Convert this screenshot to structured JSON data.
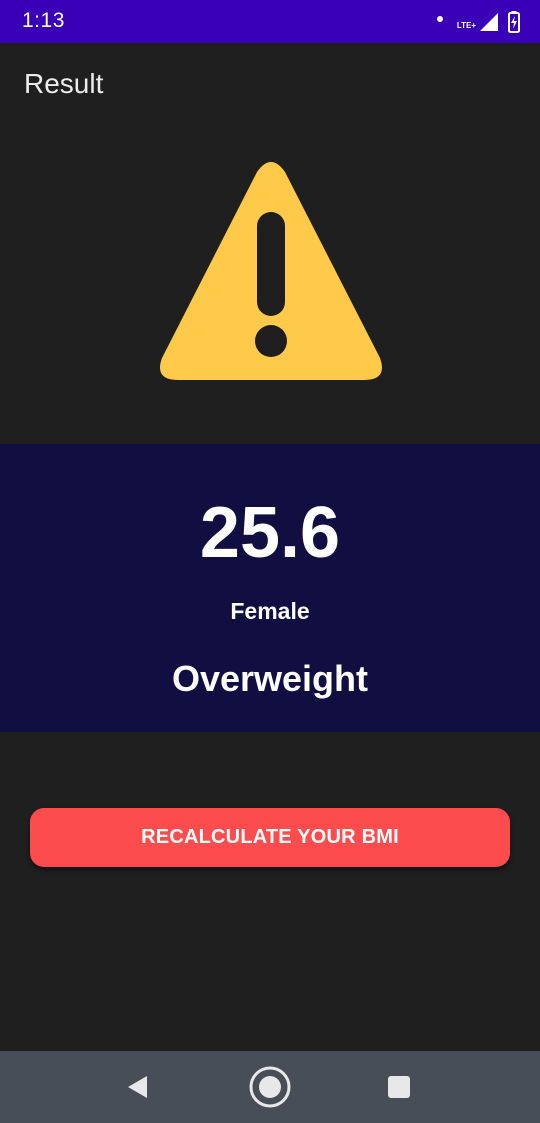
{
  "status_bar": {
    "time": "1:13",
    "network_label": "LTE+",
    "icons": [
      "notification-dot-icon",
      "lte-signal-icon",
      "battery-charging-icon"
    ],
    "background": "#3a00b8"
  },
  "app_bar": {
    "title": "Result"
  },
  "warning": {
    "icon": "warning-icon",
    "color": "#ffc94a"
  },
  "result": {
    "bmi": "25.6",
    "gender": "Female",
    "category": "Overweight",
    "background": "#110e41"
  },
  "actions": {
    "recalculate_label": "RECALCULATE YOUR BMI",
    "button_color": "#fc4c4d"
  },
  "nav_bar": {
    "items": [
      "back-icon",
      "home-icon",
      "recents-icon"
    ]
  }
}
